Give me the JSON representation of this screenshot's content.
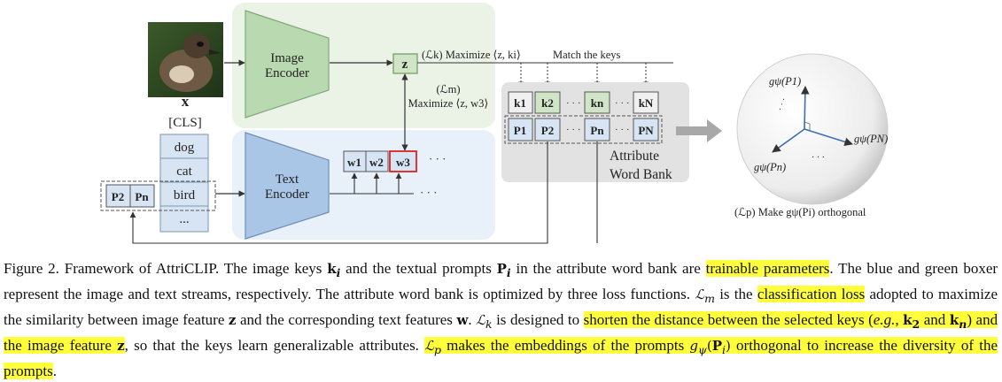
{
  "diagram": {
    "input_label": "x",
    "image_encoder": [
      "Image",
      "Encoder"
    ],
    "text_encoder": [
      "Text",
      "Encoder"
    ],
    "feature_z": "z",
    "lk_label": "(ℒk)  Maximize ⟨z, ki⟩",
    "match_keys": "Match the keys",
    "lm_label": "(ℒm)",
    "lm_maximize": "Maximize ⟨z, w3⟩",
    "cls_token": "[CLS]",
    "class_names": [
      "dog",
      "cat",
      "bird",
      "..."
    ],
    "prompt_tokens": [
      "P2",
      "Pn"
    ],
    "word_features": [
      "w1",
      "w2",
      "w3"
    ],
    "keys": [
      "k1",
      "k2",
      "kn",
      "kN"
    ],
    "prompts": [
      "P1",
      "P2",
      "Pn",
      "PN"
    ],
    "bank_label": [
      "Attribute",
      "Word Bank"
    ],
    "sphere_labels": [
      "gψ(P1)",
      "gψ(PN)",
      "gψ(Pn)"
    ],
    "lp_label": "(ℒp)  Make gψ(Pi) orthogonal"
  },
  "caption": {
    "figure_no": "Figure 2.",
    "s1_pre": "Framework of AttriCLIP. The image keys",
    "s1_mid": "and the textual prompts",
    "s1_post": "in the attribute word bank are",
    "hl_trainable": "trainable parameters",
    "s2": "The blue and green boxer represent the image and text streams, respectively. The attribute word bank is optimized by three loss functions.",
    "s3_is": "is the",
    "hl_classification": "classification loss",
    "s3_post": "adopted to maximize the similarity between image feature",
    "s3_and": "and the corresponding text features",
    "s4_is": "is designed to",
    "hl_shorten_a": "shorten the distance between the selected keys (",
    "hl_eg": "e.g.",
    "hl_shorten_b": "and",
    "hl_shorten_c": ") and the image feature",
    "s4_post": "so that the keys learn generalizable attributes.",
    "hl_lp_a": "makes the embeddings of the prompts",
    "hl_lp_b": "orthogonal to increase the diversity of the prompts",
    "period": "."
  },
  "colors": {
    "highlight": "#ffff3c",
    "green_stream": "#eaf3e6",
    "blue_stream": "#e8f0fa",
    "bank_gray": "#e2e2e2",
    "red_box": "#e02020"
  }
}
